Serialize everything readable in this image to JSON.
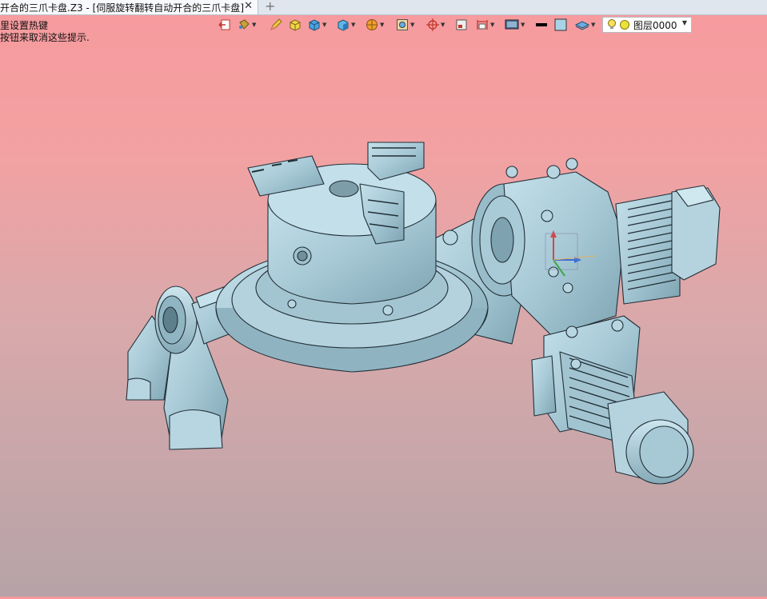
{
  "tab": {
    "title": "开合的三爪卡盘.Z3 - [伺服旋转翻转自动开合的三爪卡盘]",
    "close_glyph": "✕",
    "add_glyph": "+"
  },
  "hints": {
    "line1": "里设置热键",
    "line2": "按钮来取消这些提示."
  },
  "toolbar": {
    "icons": [
      "exit-icon",
      "bucket-icon",
      "pencil-icon",
      "box-yellow-icon",
      "box-blue-icon",
      "cube-dropdown-icon",
      "sphere-orange-icon",
      "frame-icon",
      "target-icon",
      "square-icon",
      "dimension-icon",
      "monitor-icon",
      "line-black-icon",
      "color-square-icon",
      "layer-stack-icon"
    ]
  },
  "layer_select": {
    "value": "图层0000"
  },
  "colors": {
    "model": "#a7c9d6",
    "model_dark": "#6f95a3",
    "edge": "#223038",
    "accent_bg_top": "#f69a9e",
    "accent_bg_bottom": "#b6a3a7"
  }
}
